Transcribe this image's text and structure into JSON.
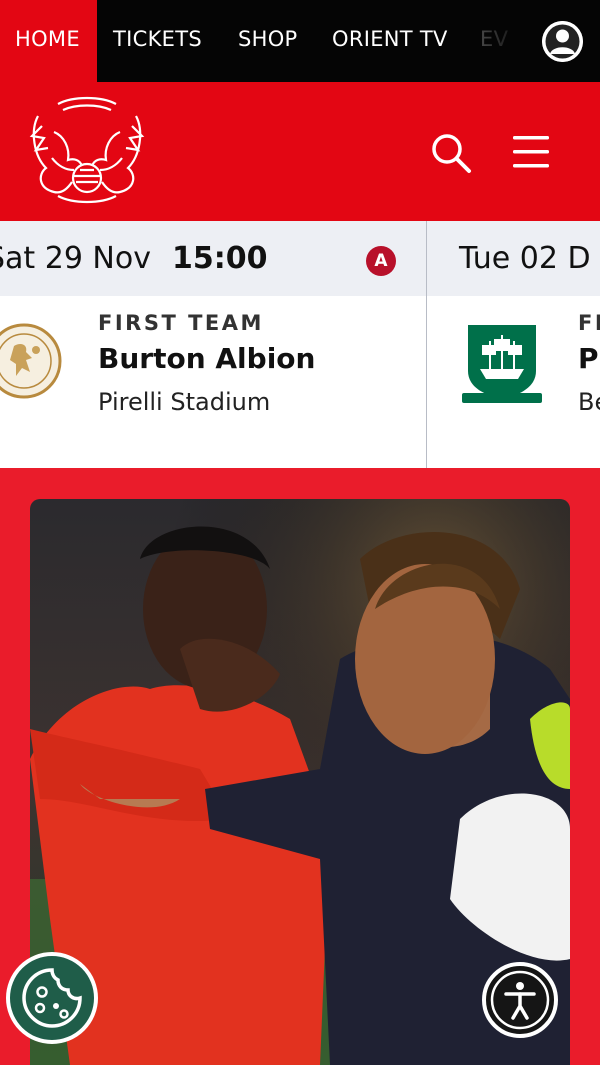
{
  "nav": {
    "items": [
      "HOME",
      "TICKETS",
      "SHOP",
      "ORIENT TV",
      "EV"
    ],
    "active": "HOME"
  },
  "header": {
    "logo": "leyton-orient-crest",
    "search_icon": "search-icon",
    "menu_icon": "hamburger-menu-icon"
  },
  "fixtures": [
    {
      "date": "Sat 29 Nov",
      "time": "15:00",
      "venue_badge": "A",
      "team": "FIRST TEAM",
      "opponent": "Burton Albion",
      "venue": "Pirelli Stadium",
      "crest": "burton-albion-crest"
    },
    {
      "date": "Tue 02 D",
      "team": "FI",
      "opponent": "Pl",
      "venue": "Be",
      "crest": "plymouth-argyle-crest"
    }
  ],
  "news": {
    "image": "two players celebrating photo"
  },
  "colors": {
    "brand_red": "#e30613",
    "page_red": "#ea1c2b",
    "nav_black": "#050505",
    "away_badge": "#b8102a",
    "cookie_green": "#1f5d49"
  }
}
